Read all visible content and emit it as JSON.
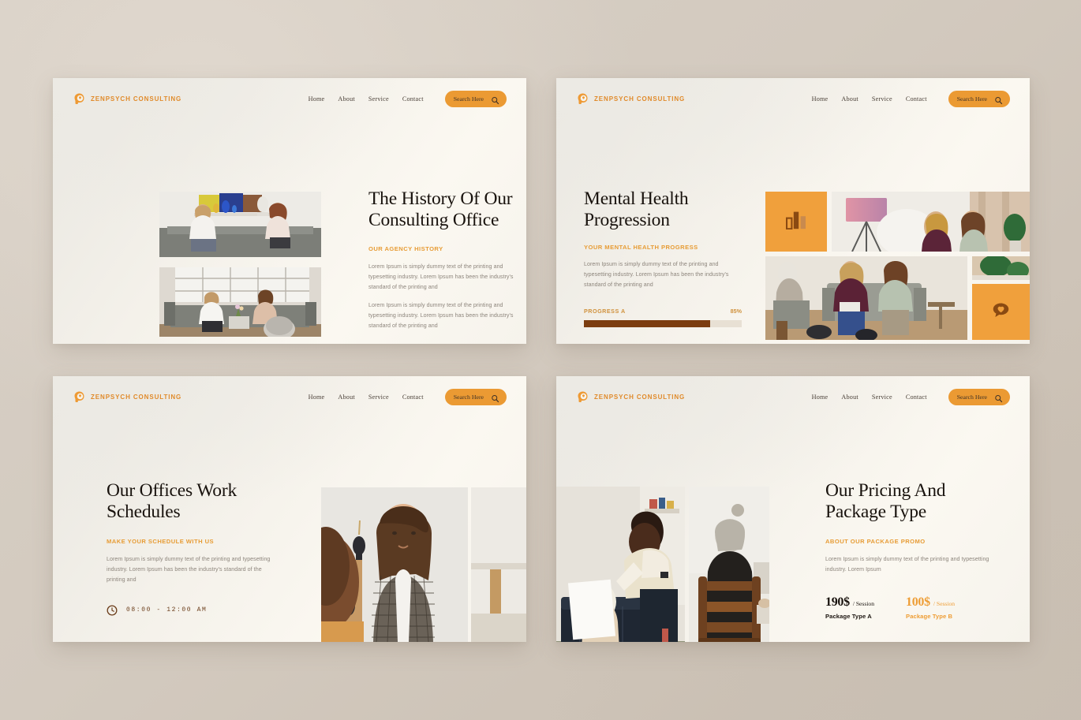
{
  "brand": {
    "name": "ZENPSYCH CONSULTING",
    "logo_icon": "head-profile-icon",
    "color": "#e08a2a"
  },
  "nav": {
    "items": [
      {
        "label": "Home"
      },
      {
        "label": "About"
      },
      {
        "label": "Service"
      },
      {
        "label": "Contact"
      }
    ],
    "search": {
      "label": "Search Here",
      "icon": "search-icon",
      "bg": "#eb9a33"
    }
  },
  "theme": {
    "page_bg": "#d3cabf",
    "slide_bg": "#f6f3ec",
    "accent_orange": "#eb9a33",
    "accent_light_orange": "#f0a03c",
    "dark_brown": "#7c3d10",
    "heading_color": "#18120d",
    "body_text_color": "#8d857c"
  },
  "slides": [
    {
      "id": "slide-1",
      "title": "The History Of Our Consulting Office",
      "eyebrow": "OUR AGENCY HISTORY",
      "paragraphs": [
        "Lorem Ipsum is simply dummy text of the printing and typesetting industry. Lorem Ipsum has been the industry's standard of the printing and",
        "Lorem Ipsum is simply dummy text of the printing and typesetting industry. Lorem Ipsum has been the industry's standard of the printing and"
      ],
      "images": [
        {
          "name": "photo-couple-on-sofa"
        },
        {
          "name": "photo-group-therapy-window"
        }
      ]
    },
    {
      "id": "slide-2",
      "title": "Mental Health Progression",
      "eyebrow": "YOUR MENTAL HEALTH PROGRESS",
      "paragraphs": [
        "Lorem Ipsum is simply dummy text of the printing and typesetting industry. Lorem Ipsum has been the industry's standard of the printing and"
      ],
      "progress": {
        "label": "PROGRESS A",
        "value": "85%",
        "percent": 80
      },
      "tiles": [
        {
          "name": "bar-chart-icon"
        },
        {
          "name": "heart-speech-bubble-icon"
        }
      ],
      "images": [
        {
          "name": "photo-lamp-room"
        },
        {
          "name": "photo-group-session"
        },
        {
          "name": "photo-plants"
        }
      ]
    },
    {
      "id": "slide-3",
      "title": "Our Offices Work Schedules",
      "eyebrow": "MAKE YOUR SCHEDULE WITH US",
      "paragraphs": [
        "Lorem Ipsum is simply dummy text of the printing and typesetting industry. Lorem Ipsum has been the industry's standard of the printing and"
      ],
      "schedule": {
        "icon": "clock-icon",
        "hours": "08:00 - 12:00 AM"
      },
      "images": [
        {
          "name": "photo-counselor-plaid-blazer"
        },
        {
          "name": "photo-office-wall"
        }
      ]
    },
    {
      "id": "slide-4",
      "title": "Our Pricing And Package Type",
      "eyebrow": "ABOUT OUR PACKAGE PROMO",
      "paragraphs": [
        "Lorem Ipsum is simply dummy text of the printing and typesetting industry. Lorem Ipsum"
      ],
      "packages": [
        {
          "amount": "190$",
          "per": "/ Session",
          "name": "Package Type A",
          "style": "dark"
        },
        {
          "amount": "100$",
          "per": "/ Session",
          "name": "Package Type B",
          "style": "orange"
        }
      ],
      "images": [
        {
          "name": "photo-child-session"
        },
        {
          "name": "photo-elder-back-chair"
        }
      ]
    }
  ]
}
